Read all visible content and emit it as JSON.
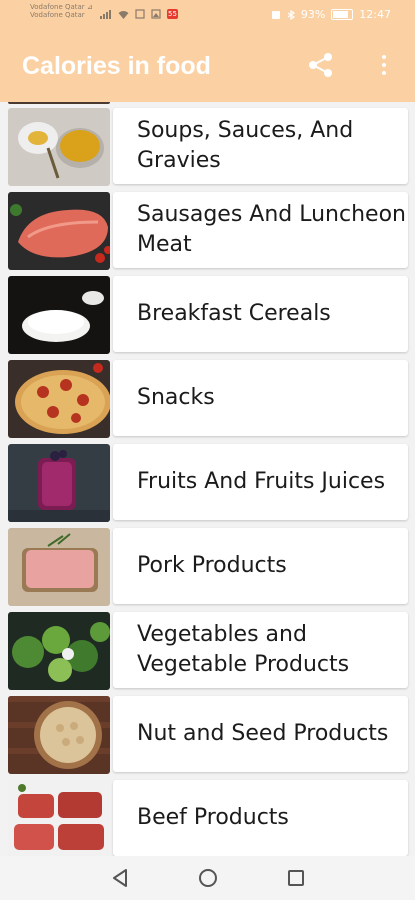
{
  "status_bar": {
    "carrier_line1": "Vodafone Qatar ⊿",
    "carrier_line2": "Vodafone Qatar",
    "notif_badge": "55",
    "battery_percent": "93%",
    "time": "12:47"
  },
  "app_bar": {
    "title": "Calories in food",
    "share_icon": "share-icon",
    "more_icon": "more-vert-icon"
  },
  "categories": [
    {
      "label": "Soups, Sauces, And Gravies",
      "image": "soup-sauce-photo"
    },
    {
      "label": "Sausages And Luncheon Meat",
      "image": "raw-meat-photo"
    },
    {
      "label": "Breakfast Cereals",
      "image": "rice-bowl-photo"
    },
    {
      "label": "Snacks",
      "image": "pizza-photo"
    },
    {
      "label": "Fruits And Fruits Juices",
      "image": "berry-smoothie-photo"
    },
    {
      "label": "Pork Products",
      "image": "ground-pork-photo"
    },
    {
      "label": "Vegetables and Vegetable Products",
      "image": "vegetables-photo"
    },
    {
      "label": "Nut and Seed Products",
      "image": "nuts-bowl-photo"
    },
    {
      "label": "Beef Products",
      "image": "beef-cuts-photo"
    }
  ],
  "nav_bar": {
    "back_icon": "back-triangle-icon",
    "home_icon": "home-circle-icon",
    "recents_icon": "recents-square-icon"
  }
}
